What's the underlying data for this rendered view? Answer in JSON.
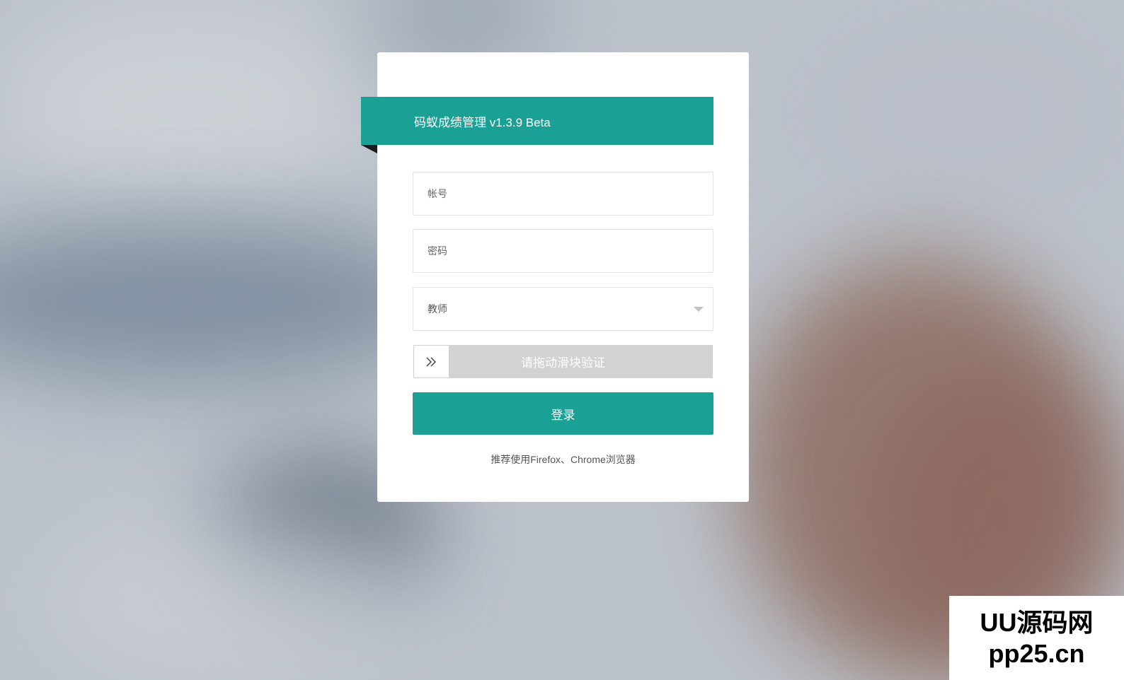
{
  "header": {
    "title": "码蚁成绩管理 v1.3.9 Beta"
  },
  "form": {
    "account_placeholder": "帐号",
    "password_placeholder": "密码",
    "role_selected": "教师",
    "slider_text": "请拖动滑块验证",
    "login_label": "登录",
    "browser_tip": "推荐使用Firefox、Chrome浏览器"
  },
  "icons": {
    "slider_handle": "double-chevron-right-icon",
    "role_dropdown": "caret-down-icon"
  },
  "colors": {
    "accent": "#1aa094",
    "slider_track": "#d2d2d2",
    "ribbon_fold": "#1b1b1b"
  },
  "watermark": {
    "line1": "UU源码网",
    "line2": "pp25.cn"
  }
}
